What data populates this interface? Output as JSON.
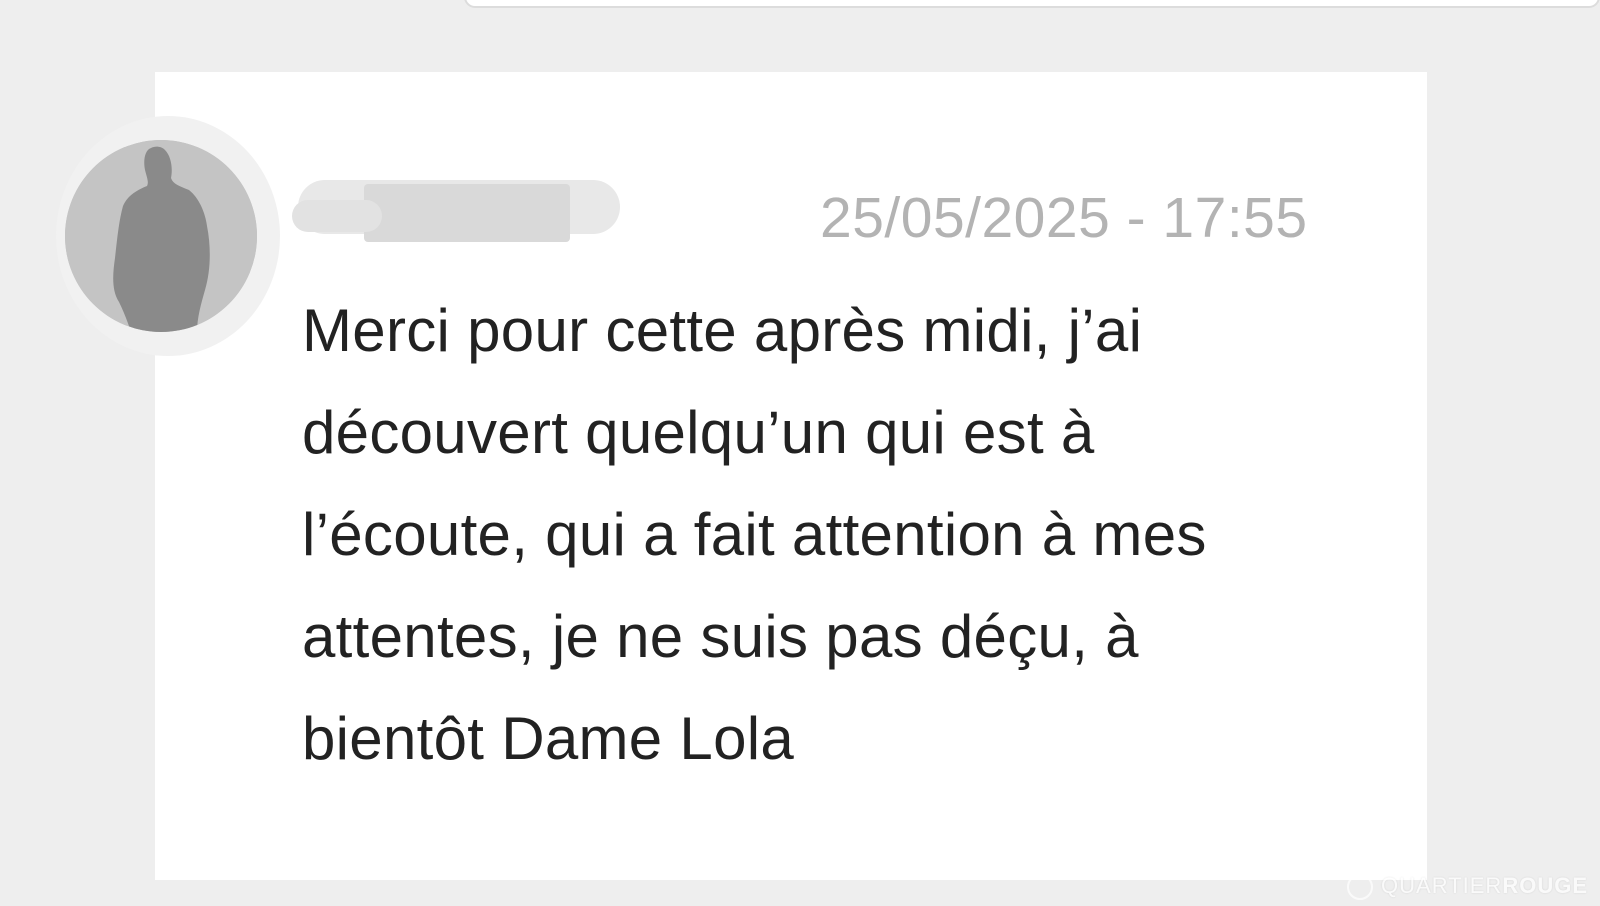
{
  "comment": {
    "author_name": "",
    "timestamp": "25/05/2025 - 17:55",
    "message_lines": [
      "Merci pour cette après midi, j’ai",
      "découvert quelqu’un qui est à",
      "l’écoute, qui a fait attention à mes",
      "attentes, je ne suis pas déçu, à",
      "bientôt Dame Lola"
    ],
    "avatar_icon": "default-person-silhouette-icon"
  },
  "watermark": {
    "part1": "QUARTIER",
    "part2": "ROUGE"
  },
  "colors": {
    "background": "#eeeeee",
    "card": "#ffffff",
    "text": "#222222",
    "timestamp": "#b3b3b3"
  }
}
